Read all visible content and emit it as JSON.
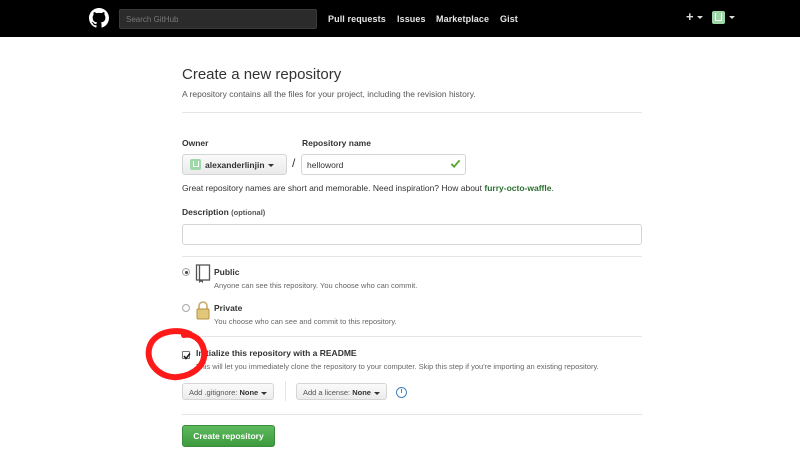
{
  "header": {
    "logo_icon": "github-octocat-icon",
    "search_placeholder": "Search GitHub",
    "nav": [
      "Pull requests",
      "Issues",
      "Marketplace",
      "Gist"
    ],
    "new_icon": "plus-icon",
    "avatar_icon": "user-avatar-icon"
  },
  "page": {
    "title": "Create a new repository",
    "subtitle": "A repository contains all the files for your project, including the revision history."
  },
  "form": {
    "owner_label": "Owner",
    "owner_value": "alexanderlinjin",
    "separator": "/",
    "repo_label": "Repository name",
    "repo_value": "helloword",
    "hint_prefix": "Great repository names are short and memorable. Need inspiration? How about ",
    "hint_suggestion": "furry-octo-waffle",
    "hint_suffix": ".",
    "description_label": "Description",
    "description_optional": "(optional)",
    "description_value": "",
    "visibility": {
      "selected": "public",
      "public_title": "Public",
      "public_note": "Anyone can see this repository. You choose who can commit.",
      "private_title": "Private",
      "private_note": "You choose who can see and commit to this repository."
    },
    "readme": {
      "checked": true,
      "title": "Initialize this repository with a README",
      "note": "This will let you immediately clone the repository to your computer. Skip this step if you're importing an existing repository."
    },
    "gitignore_prefix": "Add .gitignore:",
    "gitignore_value": "None",
    "license_prefix": "Add a license:",
    "license_value": "None",
    "info_glyph": "i",
    "submit_label": "Create repository"
  },
  "colors": {
    "header_bg": "#000000",
    "primary_button": "#3d9b3e",
    "suggestion_text": "#2c6e2f",
    "annotation_circle": "#ff0000"
  }
}
